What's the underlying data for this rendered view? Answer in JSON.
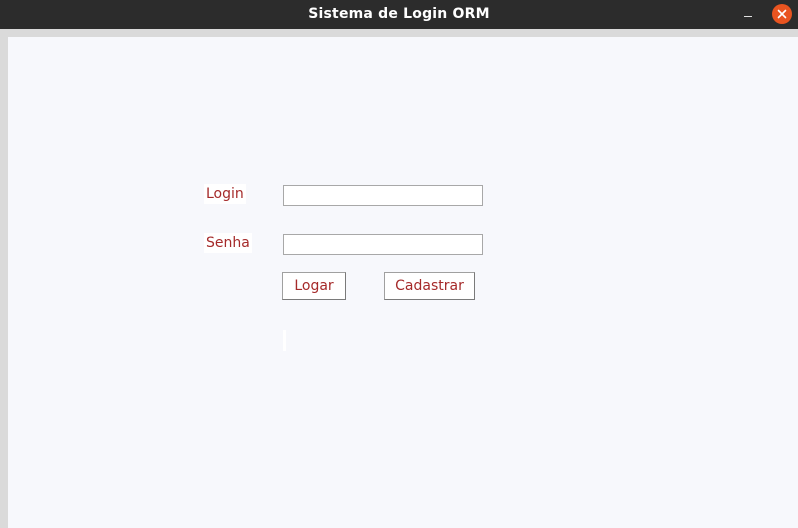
{
  "window": {
    "title": "Sistema de Login ORM",
    "minimize_glyph": "–",
    "close_icon": "close-icon"
  },
  "form": {
    "login_label": "Login",
    "login_value": "",
    "senha_label": "Senha",
    "senha_value": "",
    "logar_label": "Logar",
    "cadastrar_label": "Cadastrar",
    "status_text": ""
  },
  "colors": {
    "titlebar": "#2c2c2c",
    "close_button": "#e95420",
    "label_text": "#a52a2a",
    "client_background": "#f7f8fc"
  }
}
